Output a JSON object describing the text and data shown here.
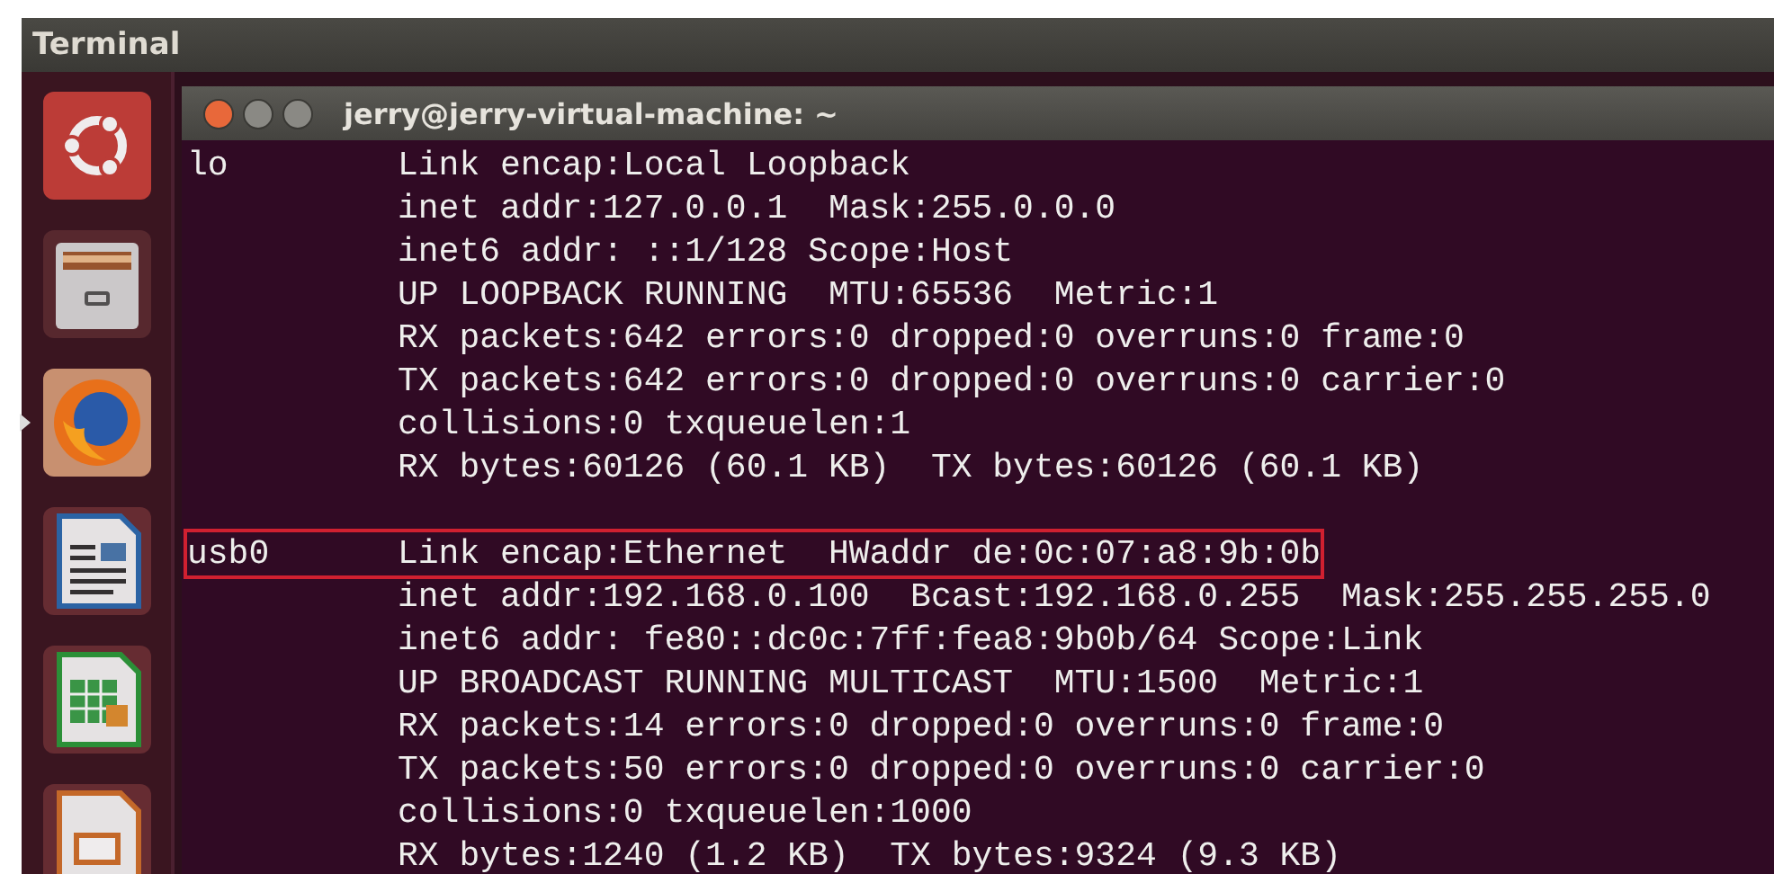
{
  "top_panel": {
    "title": "Terminal"
  },
  "launcher": [
    {
      "kind": "ubuntu",
      "running": false
    },
    {
      "kind": "files",
      "running": false
    },
    {
      "kind": "firefox",
      "running": true
    },
    {
      "kind": "writer",
      "running": false
    },
    {
      "kind": "calc",
      "running": false
    },
    {
      "kind": "impress",
      "running": false
    }
  ],
  "window": {
    "title": "jerry@jerry-virtual-machine: ~"
  },
  "interfaces": [
    {
      "name": "lo",
      "highlighted": false,
      "lines": [
        "Link encap:Local Loopback",
        "inet addr:127.0.0.1  Mask:255.0.0.0",
        "inet6 addr: ::1/128 Scope:Host",
        "UP LOOPBACK RUNNING  MTU:65536  Metric:1",
        "RX packets:642 errors:0 dropped:0 overruns:0 frame:0",
        "TX packets:642 errors:0 dropped:0 overruns:0 carrier:0",
        "collisions:0 txqueuelen:1",
        "RX bytes:60126 (60.1 KB)  TX bytes:60126 (60.1 KB)"
      ]
    },
    {
      "name": "usb0",
      "highlighted": true,
      "lines": [
        "Link encap:Ethernet  HWaddr de:0c:07:a8:9b:0b",
        "inet addr:192.168.0.100  Bcast:192.168.0.255  Mask:255.255.255.0",
        "inet6 addr: fe80::dc0c:7ff:fea8:9b0b/64 Scope:Link",
        "UP BROADCAST RUNNING MULTICAST  MTU:1500  Metric:1",
        "RX packets:14 errors:0 dropped:0 overruns:0 frame:0",
        "TX packets:50 errors:0 dropped:0 overruns:0 carrier:0",
        "collisions:0 txqueuelen:1000",
        "RX bytes:1240 (1.2 KB)  TX bytes:9324 (9.3 KB)"
      ]
    }
  ]
}
